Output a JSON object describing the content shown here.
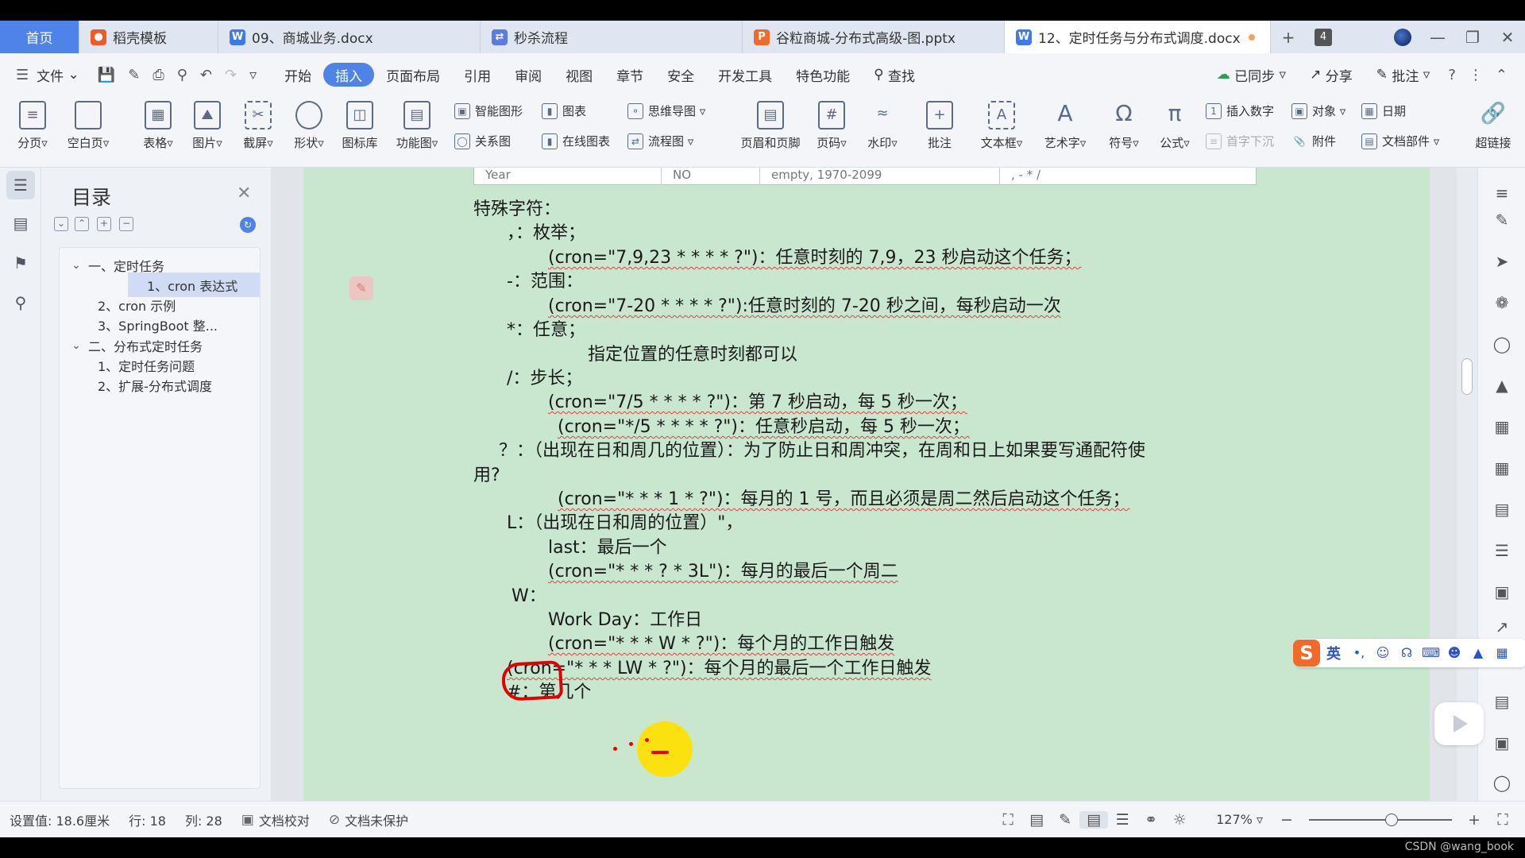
{
  "tabs": [
    {
      "label": "首页",
      "type": "home"
    },
    {
      "label": "稻壳模板",
      "icon": "docer-icon",
      "color": "#ef5a2a"
    },
    {
      "label": "09、商城业务.docx",
      "icon": "word-doc-icon",
      "color": "#3f7ae6"
    },
    {
      "label": "秒杀流程",
      "icon": "flowchart-doc-icon",
      "color": "#5b7be0"
    },
    {
      "label": "谷粒商城-分布式高级-图.pptx",
      "icon": "ppt-doc-icon",
      "color": "#f06a2a"
    },
    {
      "label": "12、定时任务与分布式调度.docx",
      "icon": "word-doc-icon",
      "color": "#3f7ae6",
      "active": true
    }
  ],
  "tab_count": "4",
  "menu": {
    "file": "文件",
    "items": [
      "开始",
      "插入",
      "页面布局",
      "引用",
      "审阅",
      "视图",
      "章节",
      "安全",
      "开发工具",
      "特色功能"
    ],
    "active": "插入",
    "search": "查找",
    "sync": "已同步",
    "share": "分享",
    "comment": "批注"
  },
  "ribbon": {
    "big": [
      "分页",
      "空白页",
      "表格",
      "图片",
      "截屏",
      "形状",
      "图标库",
      "功能图"
    ],
    "small_col1": [
      "智能图形",
      "关系图"
    ],
    "small_col2": [
      "图表",
      "在线图表"
    ],
    "small_col3": [
      "思维导图",
      "流程图"
    ],
    "big2": [
      "页眉和页脚",
      "页码",
      "水印",
      "批注",
      "文本框",
      "艺术字",
      "符号",
      "公式"
    ],
    "small_col4": [
      "插入数字",
      "首字下沉"
    ],
    "small_col5": [
      "对象",
      "附件"
    ],
    "small_col6": [
      "日期",
      "文档部件"
    ],
    "big3": [
      "超链接"
    ]
  },
  "toc": {
    "title": "目录",
    "items": [
      {
        "label": "一、定时任务",
        "level": 1,
        "expanded": true
      },
      {
        "label": "1、cron 表达式",
        "level": 2,
        "selected": true
      },
      {
        "label": "2、cron 示例",
        "level": 2
      },
      {
        "label": "3、SpringBoot 整...",
        "level": 2
      },
      {
        "label": "二、分布式定时任务",
        "level": 1,
        "expanded": true
      },
      {
        "label": "1、定时任务问题",
        "level": 2
      },
      {
        "label": "2、扩展-分布式调度",
        "level": 2
      }
    ]
  },
  "table_strip": [
    "Year",
    "NO",
    "empty, 1970-2099",
    ", - * /"
  ],
  "document": {
    "lines": [
      "特殊字符：",
      "，：枚举；",
      "(cron=\"7,9,23 * * * * ?\")：任意时刻的 7,9，23 秒启动这个任务；",
      "-：范围：",
      "(cron=\"7-20 * * * * ?\"):任意时刻的 7-20 秒之间，每秒启动一次",
      "*：任意；",
      "指定位置的任意时刻都可以",
      "/：步长；",
      "(cron=\"7/5 * * * * ?\")：第 7 秒启动，每 5 秒一次；",
      "(cron=\"*/5 * * * * ?\")：任意秒启动，每 5 秒一次；",
      "？：（出现在日和周几的位置）：为了防止日和周冲突，在周和日上如果要写通配符使",
      "用?",
      "(cron=\"* * * 1 * ?\")：每月的 1 号，而且必须是周二然后启动这个任务；",
      "L：（出现在日和周的位置）\"，",
      "last：最后一个",
      "(cron=\"* * * ? * 3L\")：每月的最后一个周二",
      "W：",
      "Work Day：工作日",
      "(cron=\"* * * W * ?\")：每个月的工作日触发",
      "(cron=\"* * * LW * ?\")：每个月的最后一个工作日触发",
      "#：第几个"
    ]
  },
  "ime": {
    "lang": "英"
  },
  "status": {
    "setting": "设置值: 18.6厘米",
    "row": "行: 18",
    "col": "列: 28",
    "proof": "文档校对",
    "protect": "文档未保护",
    "zoom": "127%"
  },
  "watermark": "CSDN @wang_book",
  "colors": {
    "accent": "#4f83e8",
    "page_bg": "#c9e7cf",
    "annotation_red": "#e30000",
    "highlight_yellow": "#ffe100"
  }
}
